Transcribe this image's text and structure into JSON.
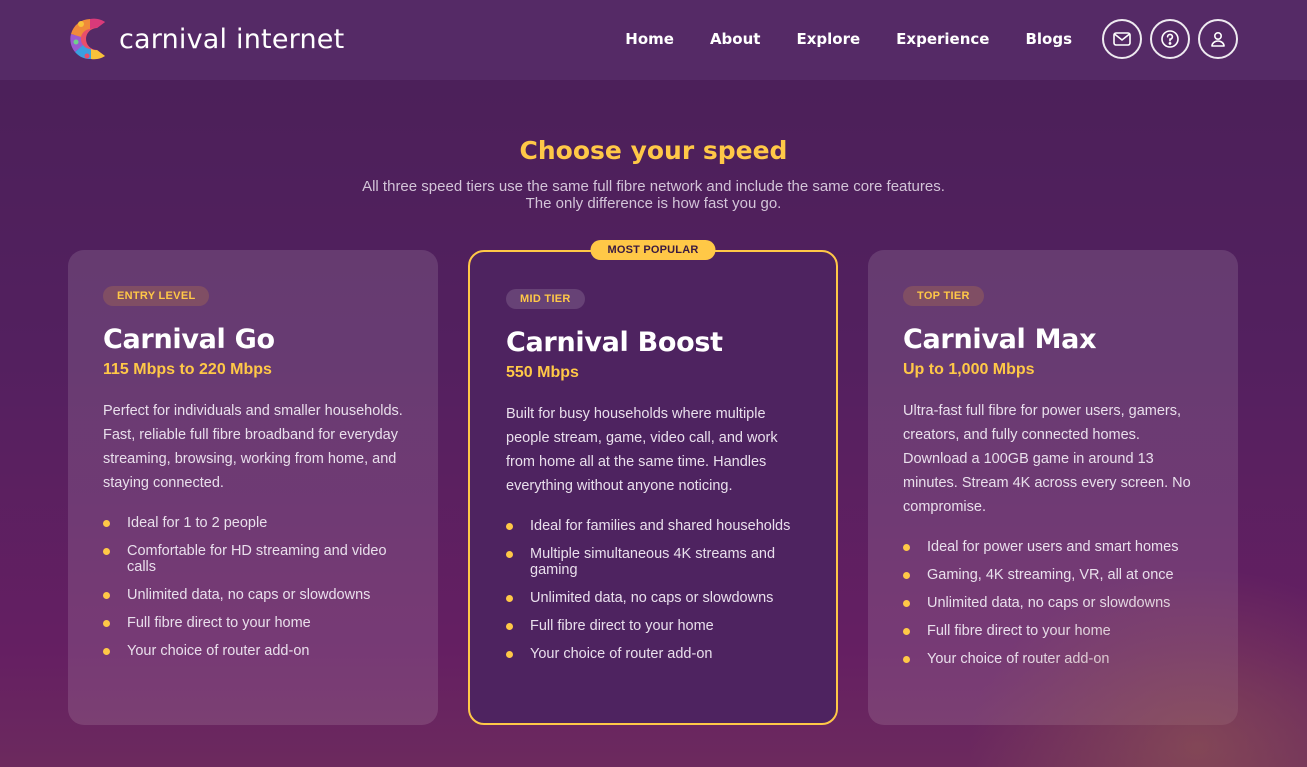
{
  "brand": {
    "name": "carnival internet"
  },
  "nav": {
    "links": [
      "Home",
      "About",
      "Explore",
      "Experience",
      "Blogs"
    ],
    "icons": [
      "mail-icon",
      "help-icon",
      "user-icon"
    ]
  },
  "section": {
    "title": "Choose your speed",
    "subtitle_line1": "All three speed tiers use the same full fibre network and include the same core features.",
    "subtitle_line2": "The only difference is how fast you go."
  },
  "colors": {
    "accent": "#ffc847",
    "header_bg": "#552a66",
    "page_bg": "#53205f"
  },
  "plans": [
    {
      "tier": "ENTRY LEVEL",
      "name": "Carnival Go",
      "speed": "115 Mbps to 220 Mbps",
      "description": "Perfect for individuals and smaller households. Fast, reliable full fibre broadband for everyday streaming, browsing, working from home, and staying connected.",
      "features": [
        "Ideal for 1 to 2 people",
        "Comfortable for HD streaming and video calls",
        "Unlimited data, no caps or slowdowns",
        "Full fibre direct to your home",
        "Your choice of router add-on"
      ]
    },
    {
      "badge": "MOST POPULAR",
      "tier": "MID TIER",
      "name": "Carnival Boost",
      "speed": "550 Mbps",
      "description": "Built for busy households where multiple people stream, game, video call, and work from home all at the same time. Handles everything without anyone noticing.",
      "features": [
        "Ideal for families and shared households",
        "Multiple simultaneous 4K streams and gaming",
        "Unlimited data, no caps or slowdowns",
        "Full fibre direct to your home",
        "Your choice of router add-on"
      ]
    },
    {
      "tier": "TOP TIER",
      "name": "Carnival Max",
      "speed": "Up to 1,000 Mbps",
      "description": "Ultra-fast full fibre for power users, gamers, creators, and fully connected homes. Download a 100GB game in around 13 minutes. Stream 4K across every screen. No compromise.",
      "features": [
        "Ideal for power users and smart homes",
        "Gaming, 4K streaming, VR, all at once",
        "Unlimited data, no caps or slowdowns",
        "Full fibre direct to your home",
        "Your choice of router add-on"
      ]
    }
  ]
}
